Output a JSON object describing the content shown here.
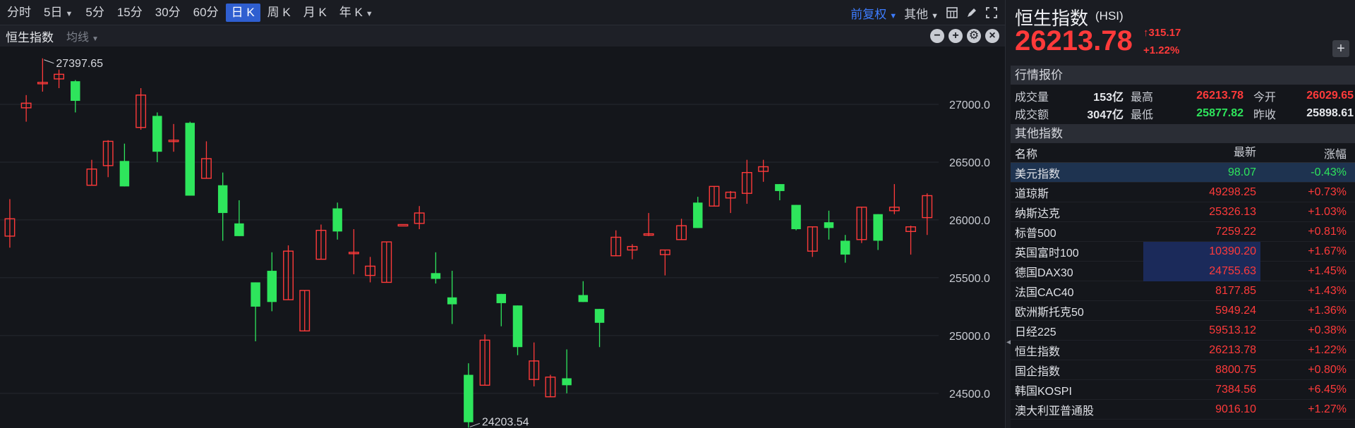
{
  "toolbar": {
    "timeframes": [
      "分时",
      "5日",
      "5分",
      "15分",
      "30分",
      "60分",
      "日 K",
      "周 K",
      "月 K",
      "年 K"
    ],
    "active_timeframe": "日 K",
    "adjust_label": "前复权",
    "other_label": "其他"
  },
  "subbar": {
    "title": "恒生指数",
    "ma_label": "均线"
  },
  "chart_data": {
    "type": "candlestick",
    "y_ticks": [
      "27000.0",
      "26500.0",
      "26000.0",
      "25500.0",
      "25000.0",
      "24500.0"
    ],
    "ylim": [
      24200,
      27500
    ],
    "high_annotation": "27397.65",
    "low_annotation": "24203.54",
    "candles": [
      {
        "o": 25860,
        "h": 26180,
        "l": 25760,
        "c": 26010
      },
      {
        "o": 26970,
        "h": 27080,
        "l": 26850,
        "c": 27010
      },
      {
        "o": 27180,
        "h": 27397.65,
        "l": 27110,
        "c": 27190
      },
      {
        "o": 27220,
        "h": 27300,
        "l": 27140,
        "c": 27260
      },
      {
        "o": 27200,
        "h": 27210,
        "l": 26930,
        "c": 27030
      },
      {
        "o": 26300,
        "h": 26520,
        "l": 26380,
        "c": 26440
      },
      {
        "o": 26470,
        "h": 26690,
        "l": 26370,
        "c": 26680
      },
      {
        "o": 26510,
        "h": 26660,
        "l": 26390,
        "c": 26290
      },
      {
        "o": 26800,
        "h": 27140,
        "l": 26780,
        "c": 27080
      },
      {
        "o": 26900,
        "h": 26930,
        "l": 26500,
        "c": 26590
      },
      {
        "o": 26690,
        "h": 26830,
        "l": 26590,
        "c": 26690
      },
      {
        "o": 26840,
        "h": 26850,
        "l": 26380,
        "c": 26210
      },
      {
        "o": 26360,
        "h": 26680,
        "l": 26480,
        "c": 26530
      },
      {
        "o": 26300,
        "h": 26410,
        "l": 25820,
        "c": 26060
      },
      {
        "o": 25970,
        "h": 26170,
        "l": 25970,
        "c": 25860
      },
      {
        "o": 25460,
        "h": 25460,
        "l": 24950,
        "c": 25250
      },
      {
        "o": 25560,
        "h": 25720,
        "l": 25210,
        "c": 25290
      },
      {
        "o": 25310,
        "h": 25780,
        "l": 25310,
        "c": 25730
      },
      {
        "o": 25040,
        "h": 25130,
        "l": 25060,
        "c": 25390
      },
      {
        "o": 25660,
        "h": 25960,
        "l": 25680,
        "c": 25910
      },
      {
        "o": 26100,
        "h": 26150,
        "l": 25830,
        "c": 25900
      },
      {
        "o": 25720,
        "h": 25920,
        "l": 25530,
        "c": 25720
      },
      {
        "o": 25520,
        "h": 25680,
        "l": 25460,
        "c": 25600
      },
      {
        "o": 25460,
        "h": 25420,
        "l": 25610,
        "c": 25810
      },
      {
        "o": 25960,
        "h": 25930,
        "l": 26250,
        "c": 25960
      },
      {
        "o": 25970,
        "h": 26120,
        "l": 25920,
        "c": 26060
      },
      {
        "o": 25540,
        "h": 25720,
        "l": 25450,
        "c": 25490
      },
      {
        "o": 25330,
        "h": 25560,
        "l": 25100,
        "c": 25270
      },
      {
        "o": 24660,
        "h": 24760,
        "l": 24203.54,
        "c": 24250
      },
      {
        "o": 24570,
        "h": 25010,
        "l": 24630,
        "c": 24960
      },
      {
        "o": 25360,
        "h": 25320,
        "l": 25080,
        "c": 25280
      },
      {
        "o": 25260,
        "h": 25260,
        "l": 24830,
        "c": 24900
      },
      {
        "o": 24620,
        "h": 24940,
        "l": 24560,
        "c": 24780
      },
      {
        "o": 24470,
        "h": 24660,
        "l": 24480,
        "c": 24640
      },
      {
        "o": 24630,
        "h": 24880,
        "l": 24500,
        "c": 24570
      },
      {
        "o": 25350,
        "h": 25470,
        "l": 25380,
        "c": 25290
      },
      {
        "o": 25230,
        "h": 25210,
        "l": 24900,
        "c": 25110
      },
      {
        "o": 25690,
        "h": 25910,
        "l": 25750,
        "c": 25850
      },
      {
        "o": 25740,
        "h": 25790,
        "l": 25660,
        "c": 25770
      },
      {
        "o": 25880,
        "h": 26060,
        "l": 25860,
        "c": 25880
      },
      {
        "o": 25700,
        "h": 25560,
        "l": 25520,
        "c": 25740
      },
      {
        "o": 25830,
        "h": 26010,
        "l": 25950,
        "c": 25950
      },
      {
        "o": 26150,
        "h": 26200,
        "l": 25970,
        "c": 25930
      },
      {
        "o": 26120,
        "h": 26290,
        "l": 26400,
        "c": 26290
      },
      {
        "o": 26190,
        "h": 26250,
        "l": 26060,
        "c": 26240
      },
      {
        "o": 26230,
        "h": 26520,
        "l": 26140,
        "c": 26410
      },
      {
        "o": 26420,
        "h": 26520,
        "l": 26330,
        "c": 26460
      },
      {
        "o": 26310,
        "h": 26300,
        "l": 26170,
        "c": 26250
      },
      {
        "o": 26130,
        "h": 26100,
        "l": 25910,
        "c": 25920
      },
      {
        "o": 25730,
        "h": 25920,
        "l": 25680,
        "c": 25940
      },
      {
        "o": 25980,
        "h": 26080,
        "l": 25830,
        "c": 25930
      },
      {
        "o": 25820,
        "h": 25870,
        "l": 25630,
        "c": 25700
      },
      {
        "o": 25830,
        "h": 26110,
        "l": 25800,
        "c": 26110
      },
      {
        "o": 26050,
        "h": 26050,
        "l": 25740,
        "c": 25820
      },
      {
        "o": 26080,
        "h": 26310,
        "l": 26050,
        "c": 26110
      },
      {
        "o": 25900,
        "h": 25950,
        "l": 25700,
        "c": 25940
      },
      {
        "o": 26020,
        "h": 26230,
        "l": 25870,
        "c": 26210
      }
    ]
  },
  "panel": {
    "name": "恒生指数",
    "code": "(HSI)",
    "price": "26213.78",
    "change": "315.17",
    "change_pct": "+1.22%",
    "section_quote": "行情报价",
    "quote": {
      "vol_label": "成交量",
      "vol_value": "153亿",
      "high_label": "最高",
      "high_value": "26213.78",
      "open_label": "今开",
      "open_value": "26029.65",
      "amt_label": "成交额",
      "amt_value": "3047亿",
      "low_label": "最低",
      "low_value": "25877.82",
      "prev_label": "昨收",
      "prev_value": "25898.61"
    },
    "section_other": "其他指数",
    "table_header": {
      "name": "名称",
      "last": "最新",
      "chg": "涨幅"
    },
    "rows": [
      {
        "name": "美元指数",
        "last": "98.07",
        "chg": "-0.43%"
      },
      {
        "name": "道琼斯",
        "last": "49298.25",
        "chg": "+0.73%"
      },
      {
        "name": "纳斯达克",
        "last": "25326.13",
        "chg": "+1.03%"
      },
      {
        "name": "标普500",
        "last": "7259.22",
        "chg": "+0.81%"
      },
      {
        "name": "英国富时100",
        "last": "10390.20",
        "chg": "+1.67%"
      },
      {
        "name": "德国DAX30",
        "last": "24755.63",
        "chg": "+1.45%"
      },
      {
        "name": "法国CAC40",
        "last": "8177.85",
        "chg": "+1.43%"
      },
      {
        "name": "欧洲斯托克50",
        "last": "5949.24",
        "chg": "+1.36%"
      },
      {
        "name": "日经225",
        "last": "59513.12",
        "chg": "+0.38%"
      },
      {
        "name": "恒生指数",
        "last": "26213.78",
        "chg": "+1.22%"
      },
      {
        "name": "国企指数",
        "last": "8800.75",
        "chg": "+0.80%"
      },
      {
        "name": "韩国KOSPI",
        "last": "7384.56",
        "chg": "+6.45%"
      },
      {
        "name": "澳大利亚普通股",
        "last": "9016.10",
        "chg": "+1.27%"
      }
    ]
  },
  "colors": {
    "up": "#ff3a3a",
    "down": "#2ee55c",
    "accent": "#2f5fd0"
  }
}
